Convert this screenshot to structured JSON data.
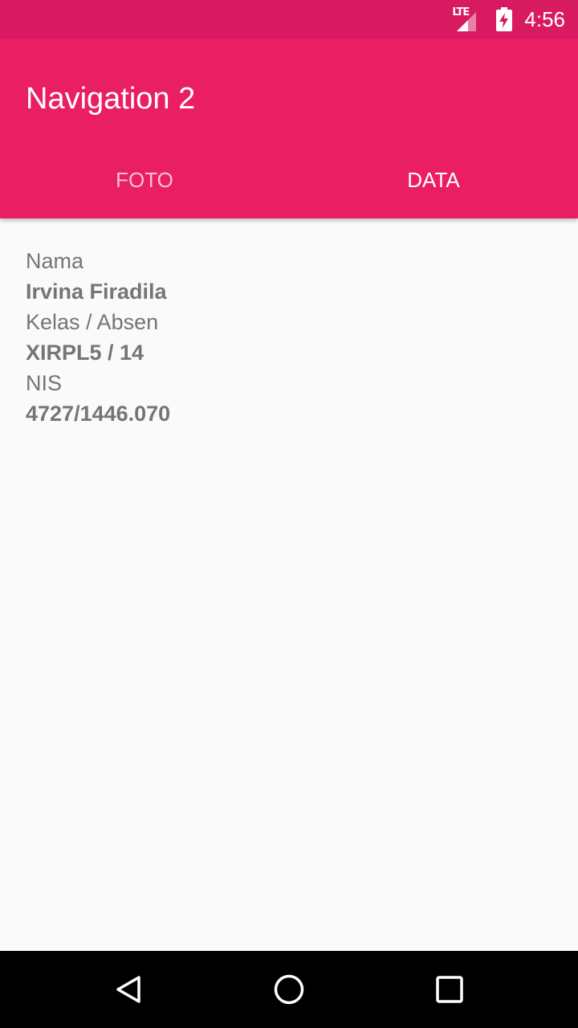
{
  "status_bar": {
    "network_label": "LTE",
    "time": "4:56",
    "icons": [
      "signal-icon",
      "battery-charging-icon"
    ],
    "background_color": "#d81b60"
  },
  "app_bar": {
    "title": "Navigation 2",
    "background_color": "#e91e63"
  },
  "tabs": [
    {
      "label": "FOTO",
      "selected": false
    },
    {
      "label": "DATA",
      "selected": true
    }
  ],
  "content": {
    "nama_label": "Nama",
    "nama_value": "Irvina Firadila",
    "kelas_label": "Kelas / Absen",
    "kelas_value": "XIRPL5 / 14",
    "nis_label": "NIS",
    "nis_value": "4727/1446.070"
  },
  "nav_bar": {
    "buttons": [
      "back-icon",
      "home-icon",
      "recents-icon"
    ]
  }
}
